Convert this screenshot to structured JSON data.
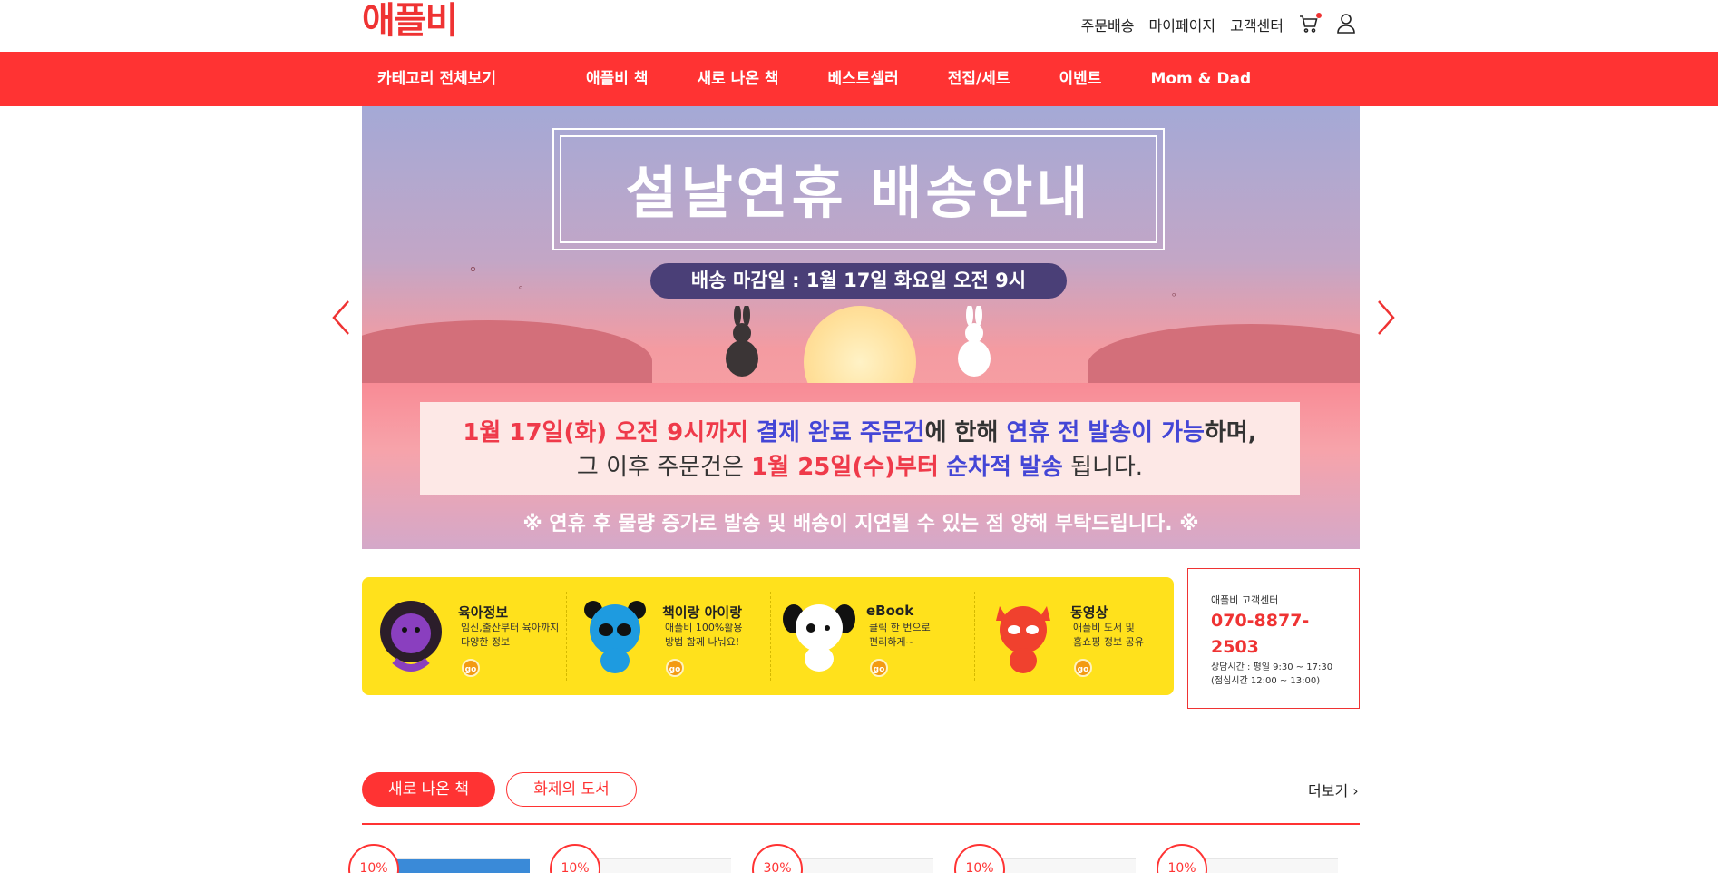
{
  "header": {
    "logo": "애플비",
    "util_links": [
      "주문배송",
      "마이페이지",
      "고객센터"
    ]
  },
  "nav": {
    "all_categories": "카테고리 전체보기",
    "menu": [
      "애플비 책",
      "새로 나온 책",
      "베스트셀러",
      "전집/세트",
      "이벤트",
      "Mom & Dad"
    ]
  },
  "banner": {
    "title": "설날연휴 배송안내",
    "deadline": "배송 마감일 : 1월 17일 화요일 오전 9시",
    "line1": {
      "a": "1월 17일(화) 오전 9시까지",
      "b": "결제 완료 주문건",
      "c": "에 한해",
      "d": "연휴 전 발송이 가능",
      "e": "하며,"
    },
    "line2": {
      "a": "그 이후 주문건은",
      "b": "1월 25일(수)부터",
      "c": "순차적 발송",
      "d": "됩니다."
    },
    "footer": "※ 연휴 후 물량 증가로 발송 및 배송이 지연될 수 있는 점 양해 부탁드립니다. ※"
  },
  "info_strip": [
    {
      "title": "육아정보",
      "desc": "임신,출산부터 육아까지\n다양한 정보",
      "go": "go",
      "character": "purple-lion",
      "color": "#8a3fbf"
    },
    {
      "title": "책이랑 아이랑",
      "desc": "애플비 100%활용\n방법 함께 나눠요!",
      "go": "go",
      "character": "blue-panda",
      "color": "#1e9be0"
    },
    {
      "title": "eBook",
      "desc": "클릭 한 번으로\n편리하게~",
      "go": "go",
      "character": "white-puppy",
      "color": "#ffffff"
    },
    {
      "title": "동영상",
      "desc": "애플비 도서 및\n홈쇼핑 정보 공유",
      "go": "go",
      "character": "red-raccoon",
      "color": "#f0412e"
    }
  ],
  "customer_center": {
    "label": "애플비 고객센터",
    "phone": "070-8877-2503",
    "hours": "상담시간 : 평일 9:30 ~ 17:30\n(점심시간 12:00 ~ 13:00)"
  },
  "books": {
    "tab_active": "새로 나온 책",
    "tab_inactive": "화제의 도서",
    "more": "더보기",
    "discounts": [
      "10%",
      "10%",
      "30%",
      "10%",
      "10%"
    ]
  },
  "colors": {
    "brand_red": "#ff3333",
    "strip_yellow": "#ffe11c",
    "deadline_purple": "#4a3f77"
  }
}
